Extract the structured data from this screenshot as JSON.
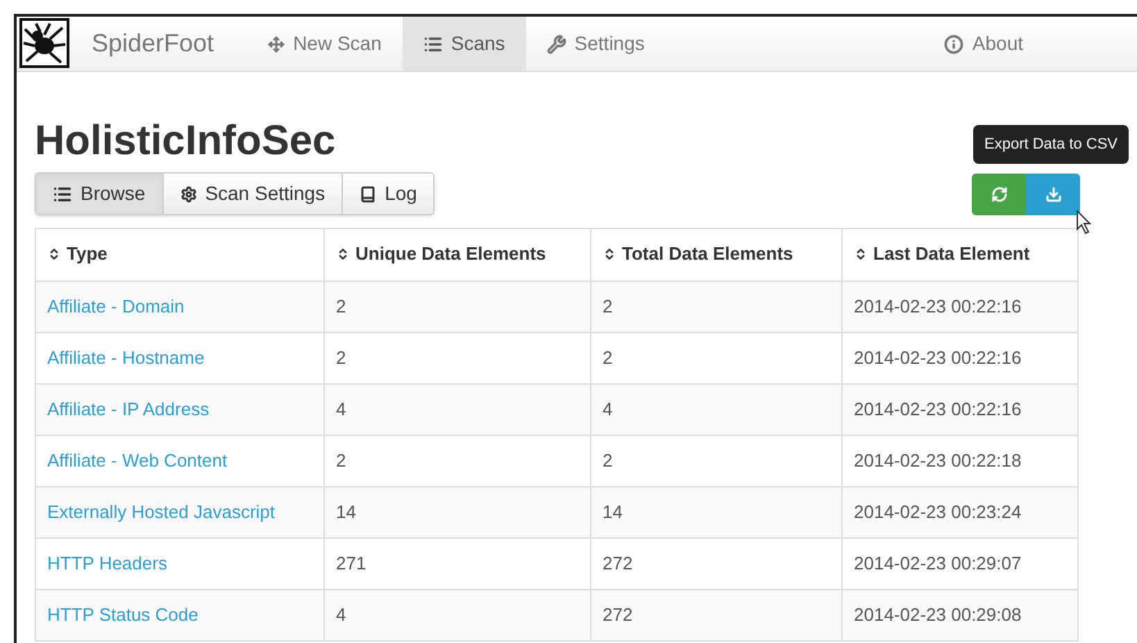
{
  "navbar": {
    "brand": "SpiderFoot",
    "items": [
      {
        "kind": "new",
        "label": "New Scan",
        "selected": false
      },
      {
        "kind": "scans",
        "label": "Scans",
        "selected": true
      },
      {
        "kind": "settings",
        "label": "Settings",
        "selected": false
      }
    ],
    "about": "About"
  },
  "title": "HolisticInfoSec",
  "tabs": [
    {
      "kind": "browse",
      "label": "Browse",
      "selected": true
    },
    {
      "kind": "settings",
      "label": "Scan Settings",
      "selected": false
    },
    {
      "kind": "log",
      "label": "Log",
      "selected": false
    }
  ],
  "tooltip": "Export Data to CSV",
  "table": {
    "columns": [
      "Type",
      "Unique Data Elements",
      "Total Data Elements",
      "Last Data Element"
    ],
    "rows": [
      [
        "Affiliate - Domain",
        "2",
        "2",
        "2014-02-23 00:22:16"
      ],
      [
        "Affiliate - Hostname",
        "2",
        "2",
        "2014-02-23 00:22:16"
      ],
      [
        "Affiliate - IP Address",
        "4",
        "4",
        "2014-02-23 00:22:16"
      ],
      [
        "Affiliate - Web Content",
        "2",
        "2",
        "2014-02-23 00:22:18"
      ],
      [
        "Externally Hosted Javascript",
        "14",
        "14",
        "2014-02-23 00:23:24"
      ],
      [
        "HTTP Headers",
        "271",
        "272",
        "2014-02-23 00:29:07"
      ],
      [
        "HTTP Status Code",
        "4",
        "272",
        "2014-02-23 00:29:08"
      ]
    ]
  }
}
